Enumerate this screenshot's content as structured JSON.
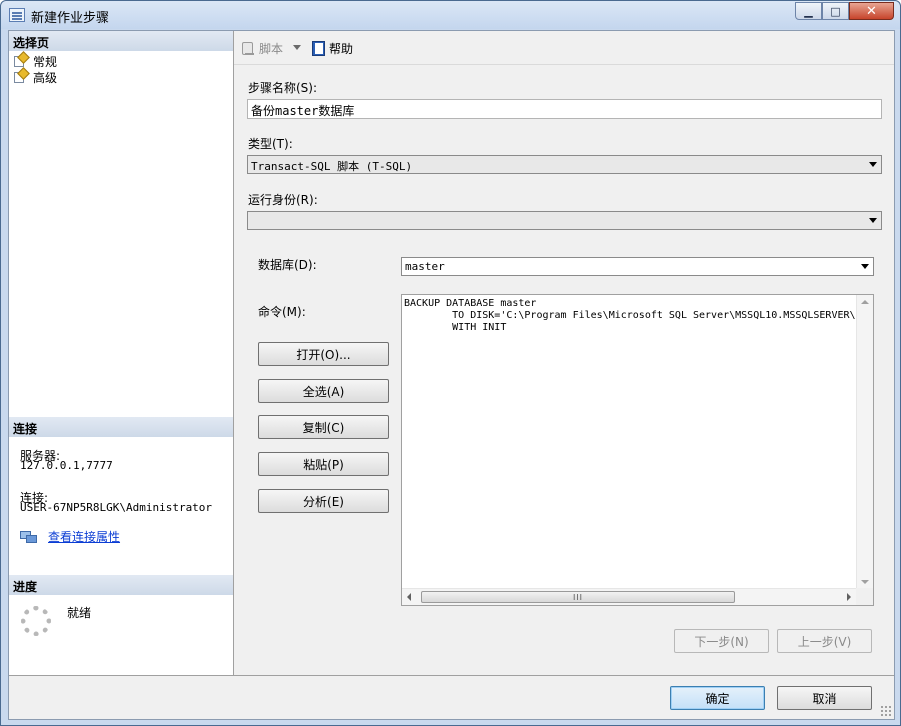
{
  "window": {
    "title": "新建作业步骤",
    "minimize": "▁",
    "maximize": "□",
    "close": "✕"
  },
  "left_panel": {
    "select_page_header": "选择页",
    "pages": [
      {
        "label": "常规",
        "icon": "page-icon"
      },
      {
        "label": "高级",
        "icon": "page-icon"
      }
    ],
    "connection_header": "连接",
    "server_label": "服务器:",
    "server_value": "127.0.0.1,7777",
    "connection_label": "连接:",
    "connection_value": "USER-67NP5R8LGK\\Administrator",
    "view_connection_link": "查看连接属性",
    "progress_header": "进度",
    "progress_status": "就绪"
  },
  "toolbar": {
    "script_label": "脚本",
    "help_label": "帮助"
  },
  "form": {
    "step_name_label": "步骤名称(S):",
    "step_name_value": "备份master数据库",
    "type_label": "类型(T):",
    "type_value": "Transact-SQL 脚本 (T-SQL)",
    "run_as_label": "运行身份(R):",
    "run_as_value": "",
    "database_label": "数据库(D):",
    "database_value": "master",
    "command_label": "命令(M):",
    "command_lines": [
      "BACKUP DATABASE master",
      "        TO DISK='C:\\Program Files\\Microsoft SQL Server\\MSSQL10.MSSQLSERVER\\",
      "        WITH INIT"
    ],
    "scroll_grip": "III"
  },
  "buttons": {
    "open": "打开(O)...",
    "select_all": "全选(A)",
    "copy": "复制(C)",
    "paste": "粘贴(P)",
    "parse": "分析(E)",
    "next": "下一步(N)",
    "previous": "上一步(V)",
    "ok": "确定",
    "cancel": "取消"
  }
}
